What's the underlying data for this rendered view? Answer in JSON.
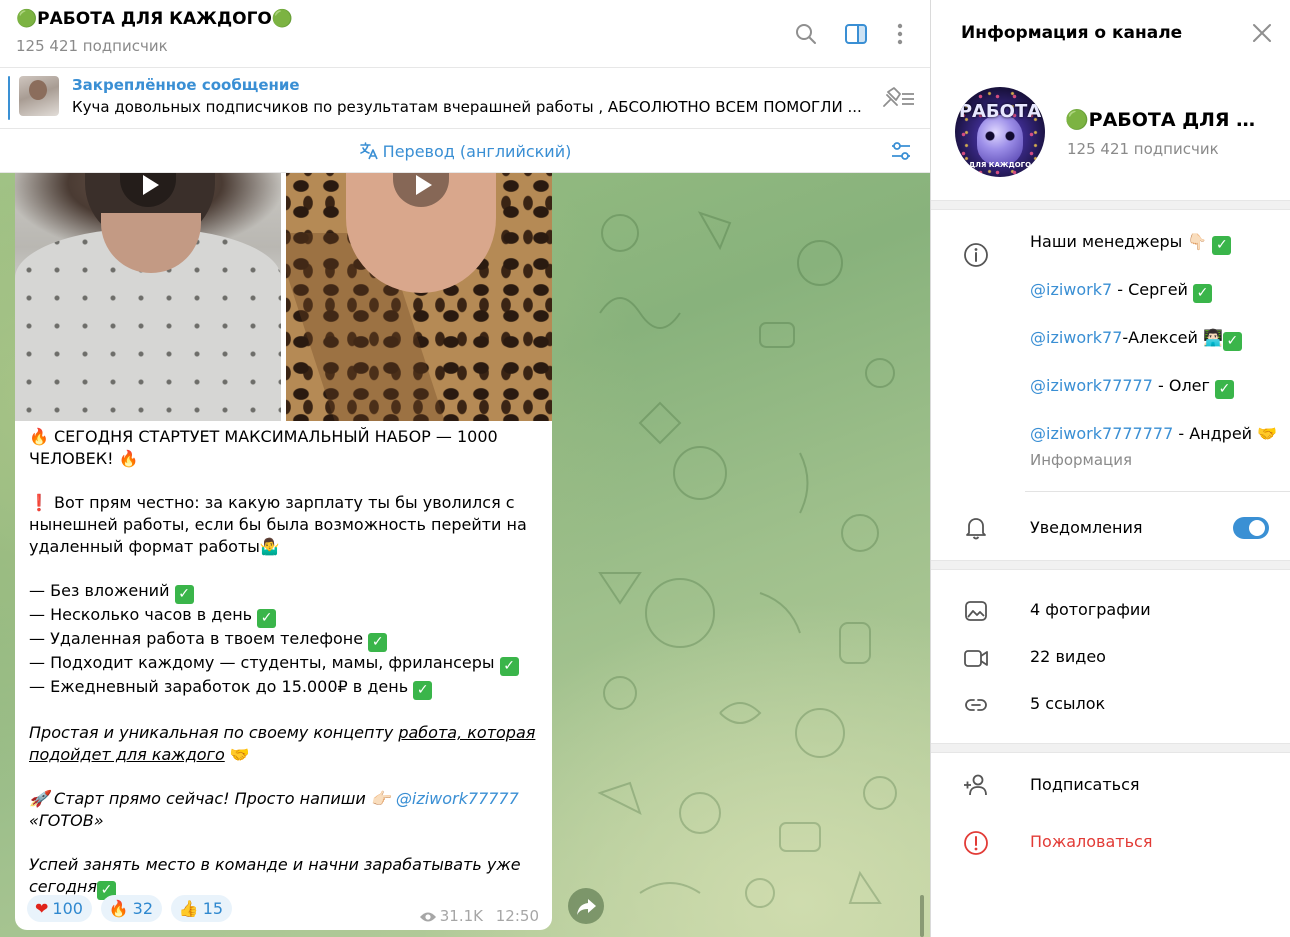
{
  "chat": {
    "title": "🟢РАБОТА ДЛЯ КАЖДОГО🟢",
    "subscribers": "125 421 подписчик",
    "pinned": {
      "title": "Закреплённое сообщение",
      "text": "Куча довольных подписчиков по результатам вчерашней работы , АБСОЛЮТНО ВСЕМ ПОМОГЛИ ..."
    },
    "translate_label": "Перевод (английский)"
  },
  "message": {
    "line1": "🔥 СЕГОДНЯ СТАРТУЕТ МАКСИМАЛЬНЫЙ НАБОР — 1000",
    "line2": "ЧЕЛОВЕК! 🔥",
    "question": "❗ Вот прям честно: за какую зарплату ты бы уволился с нынешней работы, если бы была возможность перейти на удаленный формат работы🤷‍♂️",
    "bullets": [
      "— Без вложений",
      "— Несколько часов в день",
      "— Удаленная работа в твоем телефоне",
      "— Подходит каждому — студенты, мамы, фрилансеры",
      "— Ежедневный заработок до 15.000₽ в день"
    ],
    "check": "✓",
    "concept_a": "Простая и уникальная по своему концепту ",
    "concept_link": "работа, которая подойдет для каждого",
    "concept_emoji": " 🤝",
    "start_a": "🚀 Старт прямо сейчас! Просто напиши 👉🏻 ",
    "start_mention": "@iziwork77777",
    "start_b": "«ГОТОВ»",
    "final": "Успей занять место в команде и начни зарабатывать уже сегодня",
    "reactions": [
      {
        "glyph": "❤",
        "count": "100"
      },
      {
        "glyph": "🔥",
        "count": "32"
      },
      {
        "glyph": "👍",
        "count": "15"
      }
    ],
    "views": "31.1K",
    "time": "12:50"
  },
  "panel": {
    "title": "Информация о канале",
    "avatar_brand": "РАБОТА",
    "avatar_brand_sub": "ДЛЯ КАЖДОГО",
    "name": "🟢РАБОТА ДЛЯ КАЖДОГО",
    "subscribers": "125 421 подписчик",
    "managers_heading": "Наши менеджеры 👇🏻",
    "managers": [
      {
        "handle": "@iziwork7",
        "rest": " - Сергей"
      },
      {
        "handle": "@iziwork77",
        "rest": "-Алексей 👨🏻‍💻"
      },
      {
        "handle": "@iziwork77777",
        "rest": " - Олег"
      },
      {
        "handle": "@iziwork7777777",
        "rest": " - Андрей 🤝"
      }
    ],
    "info_label": "Информация",
    "notifications_label": "Уведомления",
    "notifications_on": true,
    "media": [
      {
        "icon": "photo-icon",
        "label": "4 фотографии"
      },
      {
        "icon": "video-icon",
        "label": "22 видео"
      },
      {
        "icon": "link-icon",
        "label": "5 ссылок"
      }
    ],
    "subscribe_label": "Подписаться",
    "report_label": "Пожаловаться"
  },
  "colors": {
    "accent": "#3a8fd4",
    "danger": "#e23b36",
    "check": "#3ab54a"
  }
}
